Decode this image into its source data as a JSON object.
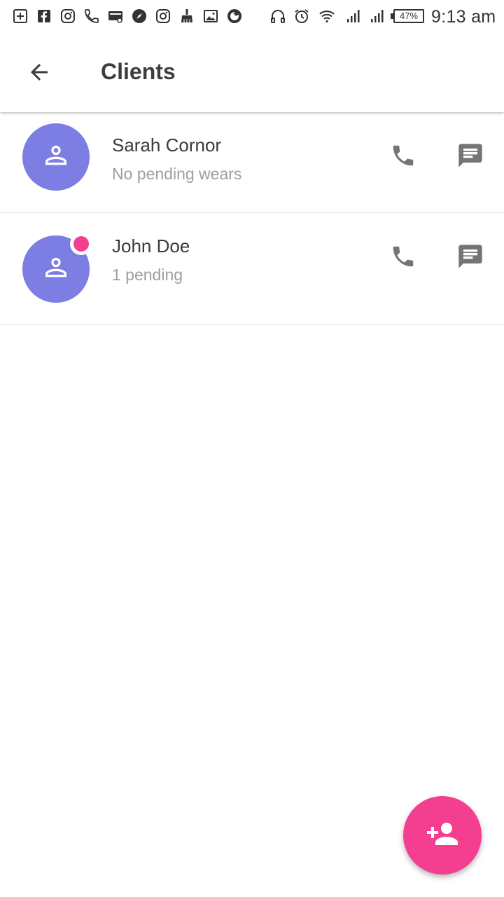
{
  "status_bar": {
    "icons": [
      "add-box-icon",
      "facebook-icon",
      "instagram-icon",
      "phone-icon",
      "card-icon",
      "compass-icon",
      "instagram-icon",
      "broom-icon",
      "image-icon",
      "firefox-icon",
      "headset-icon",
      "alarm-icon",
      "wifi-icon",
      "signal-icon",
      "signal-icon"
    ],
    "battery": "47%",
    "time": "9:13 am"
  },
  "app_bar": {
    "back_icon": "arrow-left-icon",
    "title": "Clients"
  },
  "clients": [
    {
      "name": "Sarah Cornor",
      "status": "No pending wears",
      "has_badge": false
    },
    {
      "name": "John Doe",
      "status": "1 pending",
      "has_badge": true
    }
  ],
  "colors": {
    "avatar": "#7c7ee3",
    "accent": "#f43f91",
    "icon_gray": "#757575"
  },
  "fab": {
    "icon": "person-add-icon"
  }
}
